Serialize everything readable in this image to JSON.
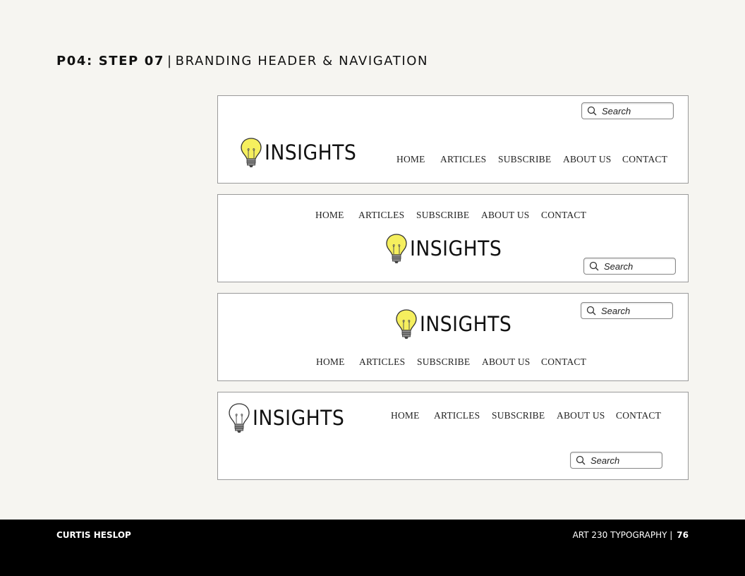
{
  "header": {
    "title_bold": "P04: STEP 07",
    "separator": "|",
    "title_rest": "BRANDING HEADER & NAVIGATION"
  },
  "brand": {
    "name": "INSIGHTS"
  },
  "nav": [
    "HOME",
    "ARTICLES",
    "SUBSCRIBE",
    "ABOUT US",
    "CONTACT"
  ],
  "search": {
    "placeholder": "Search"
  },
  "colors": {
    "bulb": "#f5ef5e",
    "background": "#f6f5f1",
    "footer": "#000000"
  },
  "footer": {
    "author": "CURTIS HESLOP",
    "course": "ART 230 TYPOGRAPHY",
    "separator": "|",
    "page": "76"
  }
}
